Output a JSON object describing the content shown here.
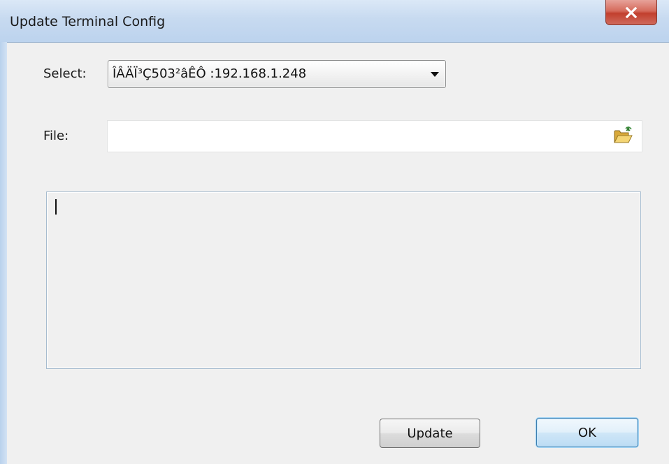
{
  "window": {
    "title": "Update Terminal Config",
    "close_glyph": "X"
  },
  "form": {
    "select_label": "Select:",
    "select_value": "ÎÂÄÏ³Ç503²âÊÔ :192.168.1.248",
    "file_label": "File:",
    "file_value": ""
  },
  "icons": {
    "dropdown": "chevron-down-icon",
    "browse": "folder-open-icon"
  },
  "buttons": {
    "update_label": "Update",
    "ok_label": "OK"
  },
  "colors": {
    "title_bar": "#c7daf0",
    "close_button": "#c2402e",
    "default_button_border": "#3c7fb1"
  }
}
